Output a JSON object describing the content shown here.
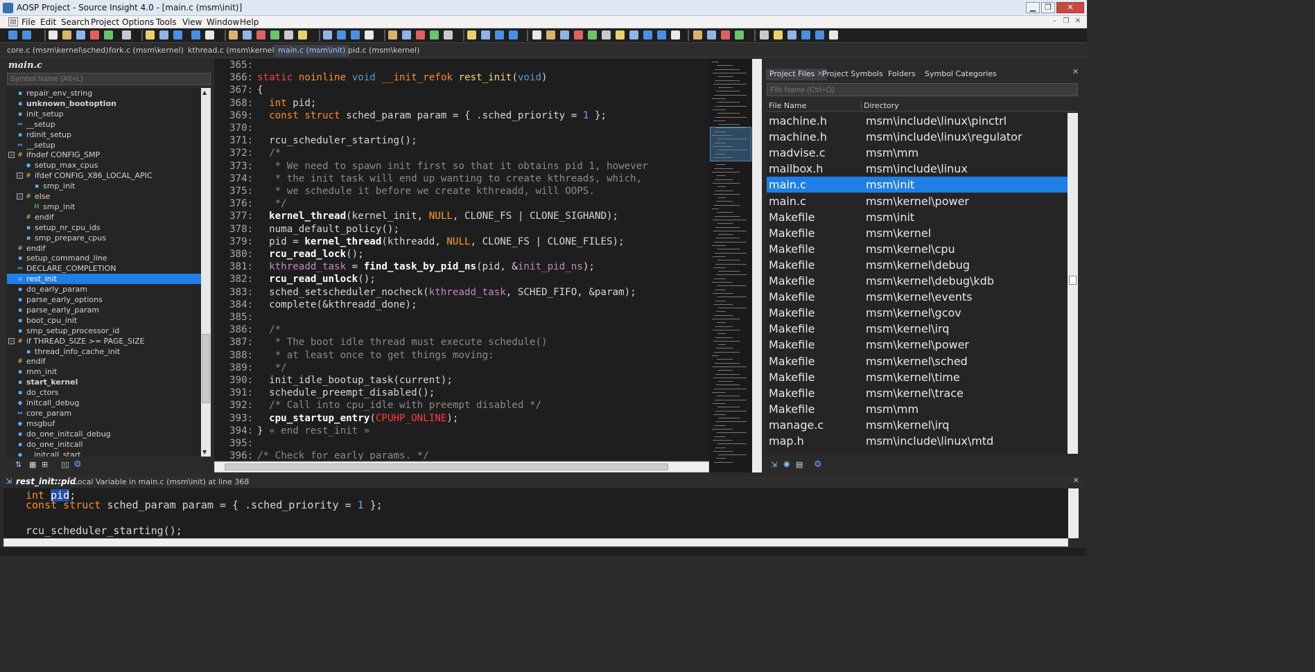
{
  "window": {
    "title": "AOSP Project - Source Insight 4.0 - [main.c (msm\\init)]",
    "minimize": "▁",
    "restore": "❐",
    "close": "✕"
  },
  "menu": [
    "File",
    "Edit",
    "Search",
    "Project",
    "Options",
    "Tools",
    "View",
    "Window",
    "Help"
  ],
  "tabs": [
    {
      "label": "core.c (msm\\kernel\\sched)",
      "active": false
    },
    {
      "label": "fork.c (msm\\kernel)",
      "active": false
    },
    {
      "label": "kthread.c (msm\\kernel)",
      "active": false
    },
    {
      "label": "main.c (msm\\init)",
      "active": true
    },
    {
      "label": "pid.c (msm\\kernel)",
      "active": false
    }
  ],
  "symbol_panel": {
    "title": "main.c",
    "search_placeholder": "Symbol Name (Alt+L)",
    "items": [
      {
        "label": "repair_env_string",
        "icon": "function",
        "indent": 0,
        "bold": false
      },
      {
        "label": "unknown_bootoption",
        "icon": "function",
        "indent": 0,
        "bold": true
      },
      {
        "label": "init_setup",
        "icon": "function",
        "indent": 0,
        "bold": false
      },
      {
        "label": "__setup",
        "icon": "macro",
        "indent": 0,
        "bold": false
      },
      {
        "label": "rdinit_setup",
        "icon": "function",
        "indent": 0,
        "bold": false
      },
      {
        "label": "__setup",
        "icon": "macro",
        "indent": 0,
        "bold": false
      },
      {
        "label": "ifndef CONFIG_SMP",
        "icon": "preproc",
        "indent": 0,
        "bold": false,
        "expander": "-"
      },
      {
        "label": "setup_max_cpus",
        "icon": "variable",
        "indent": 1,
        "bold": false
      },
      {
        "label": "ifdef CONFIG_X86_LOCAL_APIC",
        "icon": "preproc",
        "indent": 1,
        "bold": false,
        "expander": "-"
      },
      {
        "label": "smp_init",
        "icon": "function",
        "indent": 2,
        "bold": false
      },
      {
        "label": "else",
        "icon": "preproc",
        "indent": 1,
        "bold": false,
        "expander": "-"
      },
      {
        "label": "smp_init",
        "icon": "function-green",
        "indent": 2,
        "bold": false
      },
      {
        "label": "endif",
        "icon": "preproc",
        "indent": 1,
        "bold": false
      },
      {
        "label": "setup_nr_cpu_ids",
        "icon": "function",
        "indent": 1,
        "bold": false
      },
      {
        "label": "smp_prepare_cpus",
        "icon": "function",
        "indent": 1,
        "bold": false
      },
      {
        "label": "endif",
        "icon": "preproc",
        "indent": 0,
        "bold": false
      },
      {
        "label": "setup_command_line",
        "icon": "function",
        "indent": 0,
        "bold": false
      },
      {
        "label": "DECLARE_COMPLETION",
        "icon": "macro",
        "indent": 0,
        "bold": false
      },
      {
        "label": "rest_init",
        "icon": "function",
        "indent": 0,
        "bold": false,
        "selected": true
      },
      {
        "label": "do_early_param",
        "icon": "function",
        "indent": 0,
        "bold": false
      },
      {
        "label": "parse_early_options",
        "icon": "function",
        "indent": 0,
        "bold": false
      },
      {
        "label": "parse_early_param",
        "icon": "function",
        "indent": 0,
        "bold": false
      },
      {
        "label": "boot_cpu_init",
        "icon": "function",
        "indent": 0,
        "bold": false
      },
      {
        "label": "smp_setup_processor_id",
        "icon": "function",
        "indent": 0,
        "bold": false
      },
      {
        "label": "if THREAD_SIZE >= PAGE_SIZE",
        "icon": "preproc",
        "indent": 0,
        "bold": false,
        "expander": "-"
      },
      {
        "label": "thread_info_cache_init",
        "icon": "function",
        "indent": 1,
        "bold": false
      },
      {
        "label": "endif",
        "icon": "preproc",
        "indent": 0,
        "bold": false
      },
      {
        "label": "mm_init",
        "icon": "function",
        "indent": 0,
        "bold": false
      },
      {
        "label": "start_kernel",
        "icon": "function",
        "indent": 0,
        "bold": true
      },
      {
        "label": "do_ctors",
        "icon": "function",
        "indent": 0,
        "bold": false
      },
      {
        "label": "initcall_debug",
        "icon": "variable",
        "indent": 0,
        "bold": false
      },
      {
        "label": "core_param",
        "icon": "macro",
        "indent": 0,
        "bold": false
      },
      {
        "label": "msgbuf",
        "icon": "variable",
        "indent": 0,
        "bold": false
      },
      {
        "label": "do_one_initcall_debug",
        "icon": "function",
        "indent": 0,
        "bold": false
      },
      {
        "label": "do_one_initcall",
        "icon": "function",
        "indent": 0,
        "bold": false
      },
      {
        "label": "__initcall_start",
        "icon": "variable",
        "indent": 0,
        "bold": false
      }
    ]
  },
  "editor": {
    "lines": [
      {
        "n": "365:",
        "html": ""
      },
      {
        "n": "366:",
        "html": "<span class='red2'>static</span> <span class='st'>noinline</span> <span class='kw'>void</span> <span class='st'>__init_refok</span> <span class='fn'>rest_init</span>(<span class='kw'>void</span>)"
      },
      {
        "n": "367:",
        "html": "{"
      },
      {
        "n": "368:",
        "html": "  <span class='st'>int</span> pid;"
      },
      {
        "n": "369:",
        "html": "  <span class='st'>const struct</span> sched_param param = { .sched_priority = <span class='num'>1</span> };"
      },
      {
        "n": "370:",
        "html": ""
      },
      {
        "n": "371:",
        "html": "  rcu_scheduler_starting();"
      },
      {
        "n": "372:",
        "html": "  <span class='cm'>/*</span>"
      },
      {
        "n": "373:",
        "html": "<span class='cm'>   * We need to spawn init first so that it obtains pid 1, however</span>"
      },
      {
        "n": "374:",
        "html": "<span class='cm'>   * the init task will end up wanting to create kthreads, which,</span>"
      },
      {
        "n": "375:",
        "html": "<span class='cm'>   * we schedule it before we create kthreadd, will OOPS.</span>"
      },
      {
        "n": "376:",
        "html": "<span class='cm'>   */</span>"
      },
      {
        "n": "377:",
        "html": "  <span class='bld'>kernel_thread</span>(kernel_init, <span class='nul'>NULL</span>, CLONE_FS | CLONE_SIGHAND);"
      },
      {
        "n": "378:",
        "html": "  numa_default_policy();"
      },
      {
        "n": "379:",
        "html": "  pid = <span class='bld'>kernel_thread</span>(kthreadd, <span class='nul'>NULL</span>, CLONE_FS | CLONE_FILES);"
      },
      {
        "n": "380:",
        "html": "  <span class='bld'>rcu_read_lock</span>();"
      },
      {
        "n": "381:",
        "html": "  <span class='gv'>kthreadd_task</span> = <span class='bld'>find_task_by_pid_ns</span>(pid, &amp;<span class='gv'>init_pid_ns</span>);"
      },
      {
        "n": "382:",
        "html": "  <span class='bld'>rcu_read_unlock</span>();"
      },
      {
        "n": "383:",
        "html": "  sched_setscheduler_nocheck(<span class='gv'>kthreadd_task</span>, SCHED_FIFO, &amp;param);"
      },
      {
        "n": "384:",
        "html": "  complete(&amp;kthreadd_done);"
      },
      {
        "n": "385:",
        "html": ""
      },
      {
        "n": "386:",
        "html": "  <span class='cm'>/*</span>"
      },
      {
        "n": "387:",
        "html": "<span class='cm'>   * The boot idle thread must execute schedule()</span>"
      },
      {
        "n": "388:",
        "html": "<span class='cm'>   * at least once to get things moving:</span>"
      },
      {
        "n": "389:",
        "html": "<span class='cm'>   */</span>"
      },
      {
        "n": "390:",
        "html": "  init_idle_bootup_task(current);"
      },
      {
        "n": "391:",
        "html": "  schedule_preempt_disabled();"
      },
      {
        "n": "392:",
        "html": "  <span class='cm'>/* Call into cpu_idle with preempt disabled */</span>"
      },
      {
        "n": "393:",
        "html": "  <span class='bld'>cpu_startup_entry</span>(<span class='red'>CPUHP_ONLINE</span>);"
      },
      {
        "n": "394:",
        "html": "} <span class='cm'>« end rest_init »</span>"
      },
      {
        "n": "395:",
        "html": ""
      },
      {
        "n": "396:",
        "html": "<span class='cm'>/* Check for early params. */</span>"
      }
    ]
  },
  "file_panel": {
    "tabs": [
      "Project Files",
      "Project Symbols",
      "Folders",
      "Symbol Categories"
    ],
    "search_placeholder": "File Name (Ctrl+O)",
    "col_name": "File Name",
    "col_dir": "Directory",
    "rows": [
      {
        "name": "machine.h",
        "dir": "msm\\include\\linux\\pinctrl"
      },
      {
        "name": "machine.h",
        "dir": "msm\\include\\linux\\regulator"
      },
      {
        "name": "madvise.c",
        "dir": "msm\\mm"
      },
      {
        "name": "mailbox.h",
        "dir": "msm\\include\\linux"
      },
      {
        "name": "main.c",
        "dir": "msm\\init",
        "selected": true
      },
      {
        "name": "main.c",
        "dir": "msm\\kernel\\power"
      },
      {
        "name": "Makefile",
        "dir": "msm\\init"
      },
      {
        "name": "Makefile",
        "dir": "msm\\kernel"
      },
      {
        "name": "Makefile",
        "dir": "msm\\kernel\\cpu"
      },
      {
        "name": "Makefile",
        "dir": "msm\\kernel\\debug"
      },
      {
        "name": "Makefile",
        "dir": "msm\\kernel\\debug\\kdb"
      },
      {
        "name": "Makefile",
        "dir": "msm\\kernel\\events"
      },
      {
        "name": "Makefile",
        "dir": "msm\\kernel\\gcov"
      },
      {
        "name": "Makefile",
        "dir": "msm\\kernel\\irq"
      },
      {
        "name": "Makefile",
        "dir": "msm\\kernel\\power"
      },
      {
        "name": "Makefile",
        "dir": "msm\\kernel\\sched"
      },
      {
        "name": "Makefile",
        "dir": "msm\\kernel\\time"
      },
      {
        "name": "Makefile",
        "dir": "msm\\kernel\\trace"
      },
      {
        "name": "Makefile",
        "dir": "msm\\mm"
      },
      {
        "name": "manage.c",
        "dir": "msm\\kernel\\irq"
      },
      {
        "name": "map.h",
        "dir": "msm\\include\\linux\\mtd"
      }
    ]
  },
  "context": {
    "symbol": "rest_init::pid",
    "desc": "Local Variable in main.c (msm\\init) at line 368",
    "lines": [
      "<span class='st'>int</span> <span style='background:#264f9e;color:#fff'>pid</span>;",
      "<span class='st'>const struct</span> sched_param param = { .sched_priority = <span class='num'>1</span> };",
      "",
      "rcu_scheduler_starting();"
    ]
  }
}
